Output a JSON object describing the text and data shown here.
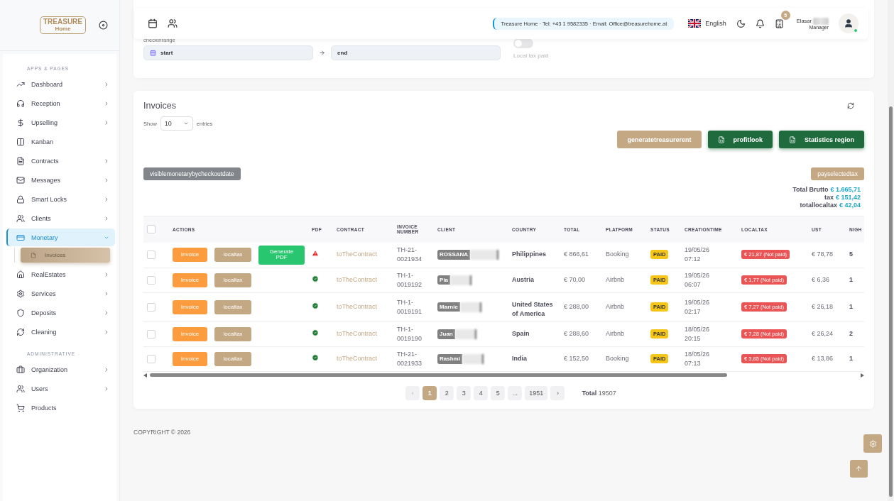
{
  "sidebar": {
    "logo": {
      "line_1": "TREASURE",
      "line_2": "Home"
    },
    "sections": [
      {
        "title": "APPS & PAGES",
        "items": [
          {
            "label": "Dashboard",
            "expanded": false,
            "selected": false
          },
          {
            "label": "Reception",
            "expanded": false,
            "selected": false
          },
          {
            "label": "Upselling",
            "expanded": false,
            "selected": false
          },
          {
            "label": "Kanban",
            "selected": false
          },
          {
            "label": "Contracts",
            "expanded": false,
            "selected": false
          },
          {
            "label": "Messages",
            "expanded": false,
            "selected": false
          },
          {
            "label": "Smart Locks",
            "expanded": false,
            "selected": false
          },
          {
            "label": "Clients",
            "expanded": false,
            "selected": false
          },
          {
            "label": "Monetary",
            "expanded": true,
            "selected": true,
            "children": [
              {
                "label": "Invoices",
                "selected": true
              }
            ]
          },
          {
            "label": "RealEstates",
            "expanded": false,
            "selected": false
          },
          {
            "label": "Services",
            "expanded": false,
            "selected": false
          },
          {
            "label": "Deposits",
            "expanded": false,
            "selected": false
          },
          {
            "label": "Cleaning",
            "expanded": false,
            "selected": false
          }
        ]
      },
      {
        "title": "ADMINISTRATIVE",
        "items": [
          {
            "label": "Organization",
            "expanded": false,
            "selected": false
          },
          {
            "label": "Users",
            "expanded": false,
            "selected": false
          },
          {
            "label": "Products",
            "selected": false
          }
        ]
      }
    ]
  },
  "navbar": {
    "info": "Treasure Home · Tel: +43 1 9582335 · Email: Office@treasurehome.at",
    "language": "English",
    "notifications_badge": "5",
    "user_name": "Elasar",
    "user_role": "Manager",
    "online": true
  },
  "filters": {
    "range_label": "checkinrange",
    "start_placeholder": "start",
    "end_placeholder": "end",
    "toggle_label": "Local tax paid",
    "local_tax_paid": false
  },
  "invoices": {
    "title": "Invoices",
    "show_label": "Show",
    "page_size": "10",
    "entries_label": "entries",
    "buttons": [
      {
        "label": "generatetreasurerent",
        "kind": "tan"
      },
      {
        "label": "profitlook",
        "kind": "excel"
      },
      {
        "label": "Statistics region",
        "kind": "excel"
      }
    ],
    "filter_button": "visiblemonetarybycheckoutdate",
    "pay_button": "payselectedtax",
    "totals": [
      {
        "label": "Total Brutto",
        "value": "€ 1.665,71"
      },
      {
        "label": "tax",
        "value": "€ 151,42"
      },
      {
        "label": "totallocaltax",
        "value": "€ 42,04"
      }
    ],
    "table": {
      "all_selected": false,
      "columns": [
        "ACTIONS",
        "PDF",
        "CONTRACT",
        "INVOICE NUMBER",
        "CLIENT",
        "COUNTRY",
        "TOTAL",
        "PLATFORM",
        "STATUS",
        "CREATIONTIME",
        "LOCALTAX",
        "UST",
        "NIGH"
      ],
      "rows": [
        {
          "checked": false,
          "actions": [
            "Invoice",
            "localtax",
            "Generate PDF"
          ],
          "pdf_ok": false,
          "contract": "toTheContract",
          "invoice_number": "TH-21-0021934",
          "client": "ROSSANA",
          "country": "Philippines",
          "total": "€ 866,61",
          "platform": "Booking",
          "status": "PAID",
          "creation_date": "19/05/26",
          "creation_time": "07:12",
          "localtax": "€ 21,87 (Not paid)",
          "ust": "€ 78,78",
          "nights": "5"
        },
        {
          "checked": false,
          "actions": [
            "Invoice",
            "localtax"
          ],
          "pdf_ok": true,
          "contract": "toTheContract",
          "invoice_number": "TH-1-0019192",
          "client": "Pia",
          "country": "Austria",
          "total": "€ 70,00",
          "platform": "Airbnb",
          "status": "PAID",
          "creation_date": "19/05/26",
          "creation_time": "06:07",
          "localtax": "€ 1,77 (Not paid)",
          "ust": "€ 6,36",
          "nights": "1"
        },
        {
          "checked": false,
          "actions": [
            "Invoice",
            "localtax"
          ],
          "pdf_ok": true,
          "contract": "toTheContract",
          "invoice_number": "TH-1-0019191",
          "client": "Marnie",
          "country": "United States of America",
          "total": "€ 288,00",
          "platform": "Airbnb",
          "status": "PAID",
          "creation_date": "19/05/26",
          "creation_time": "02:17",
          "localtax": "€ 7,27 (Not paid)",
          "ust": "€ 26,18",
          "nights": "1"
        },
        {
          "checked": false,
          "actions": [
            "Invoice",
            "localtax"
          ],
          "pdf_ok": true,
          "contract": "toTheContract",
          "invoice_number": "TH-1-0019190",
          "client": "Juan",
          "country": "Spain",
          "total": "€ 288,60",
          "platform": "Airbnb",
          "status": "PAID",
          "creation_date": "18/05/26",
          "creation_time": "20:15",
          "localtax": "€ 7,28 (Not paid)",
          "ust": "€ 26,24",
          "nights": "2"
        },
        {
          "checked": false,
          "actions": [
            "Invoice",
            "localtax"
          ],
          "pdf_ok": true,
          "contract": "toTheContract",
          "invoice_number": "TH-21-0021933",
          "client": "Rashmi",
          "country": "India",
          "total": "€ 152,50",
          "platform": "Booking",
          "status": "PAID",
          "creation_date": "18/05/26",
          "creation_time": "07:13",
          "localtax": "€ 3,85 (Not paid)",
          "ust": "€ 13,86",
          "nights": "1"
        }
      ]
    },
    "pagination": {
      "prev": "‹",
      "next": "›",
      "pages": [
        {
          "label": "1",
          "selected": true
        },
        {
          "label": "2",
          "selected": false
        },
        {
          "label": "3",
          "selected": false
        },
        {
          "label": "4",
          "selected": false
        },
        {
          "label": "5",
          "selected": false
        },
        {
          "label": "...",
          "selected": false
        },
        {
          "label": "1951",
          "selected": false
        }
      ],
      "total": "**Total** 19507"
    }
  },
  "footer": "COPYRIGHT © 2026"
}
